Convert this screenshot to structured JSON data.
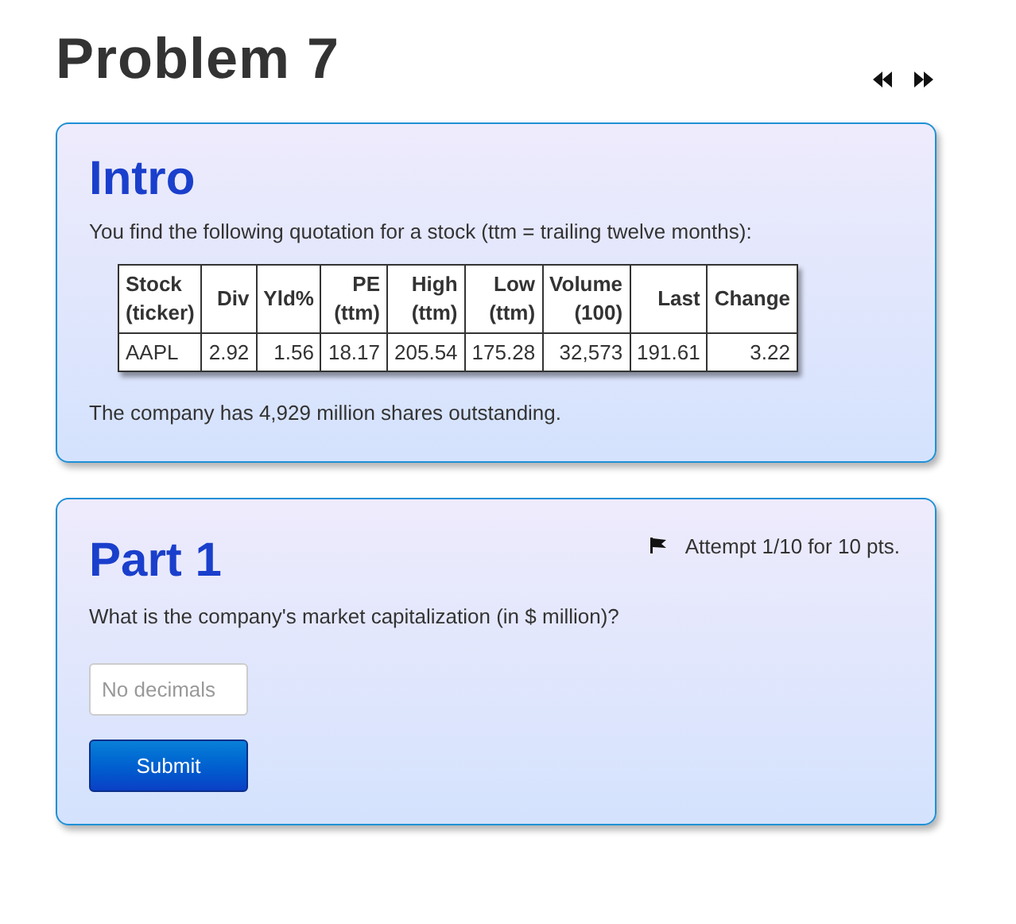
{
  "title": "Problem 7",
  "intro": {
    "heading": "Intro",
    "text": "You find the following quotation for a stock (ttm = trailing twelve months):",
    "table": {
      "columns": [
        {
          "line1": "Stock",
          "line2": "(ticker)"
        },
        {
          "line1": "Div"
        },
        {
          "line1": "Yld%"
        },
        {
          "line1": "PE",
          "line2": "(ttm)"
        },
        {
          "line1": "High",
          "line2": "(ttm)"
        },
        {
          "line1": "Low",
          "line2": "(ttm)"
        },
        {
          "line1": "Volume",
          "line2": "(100)"
        },
        {
          "line1": "Last"
        },
        {
          "line1": "Change"
        }
      ],
      "rows": [
        [
          "AAPL",
          "2.92",
          "1.56",
          "18.17",
          "205.54",
          "175.28",
          "32,573",
          "191.61",
          "3.22"
        ]
      ]
    },
    "footer": "The company has 4,929 million shares outstanding."
  },
  "part": {
    "heading": "Part 1",
    "attempt": "Attempt 1/10 for 10 pts.",
    "question": "What is the company's market capitalization (in $ million)?",
    "placeholder": "No decimals",
    "button": "Submit"
  }
}
